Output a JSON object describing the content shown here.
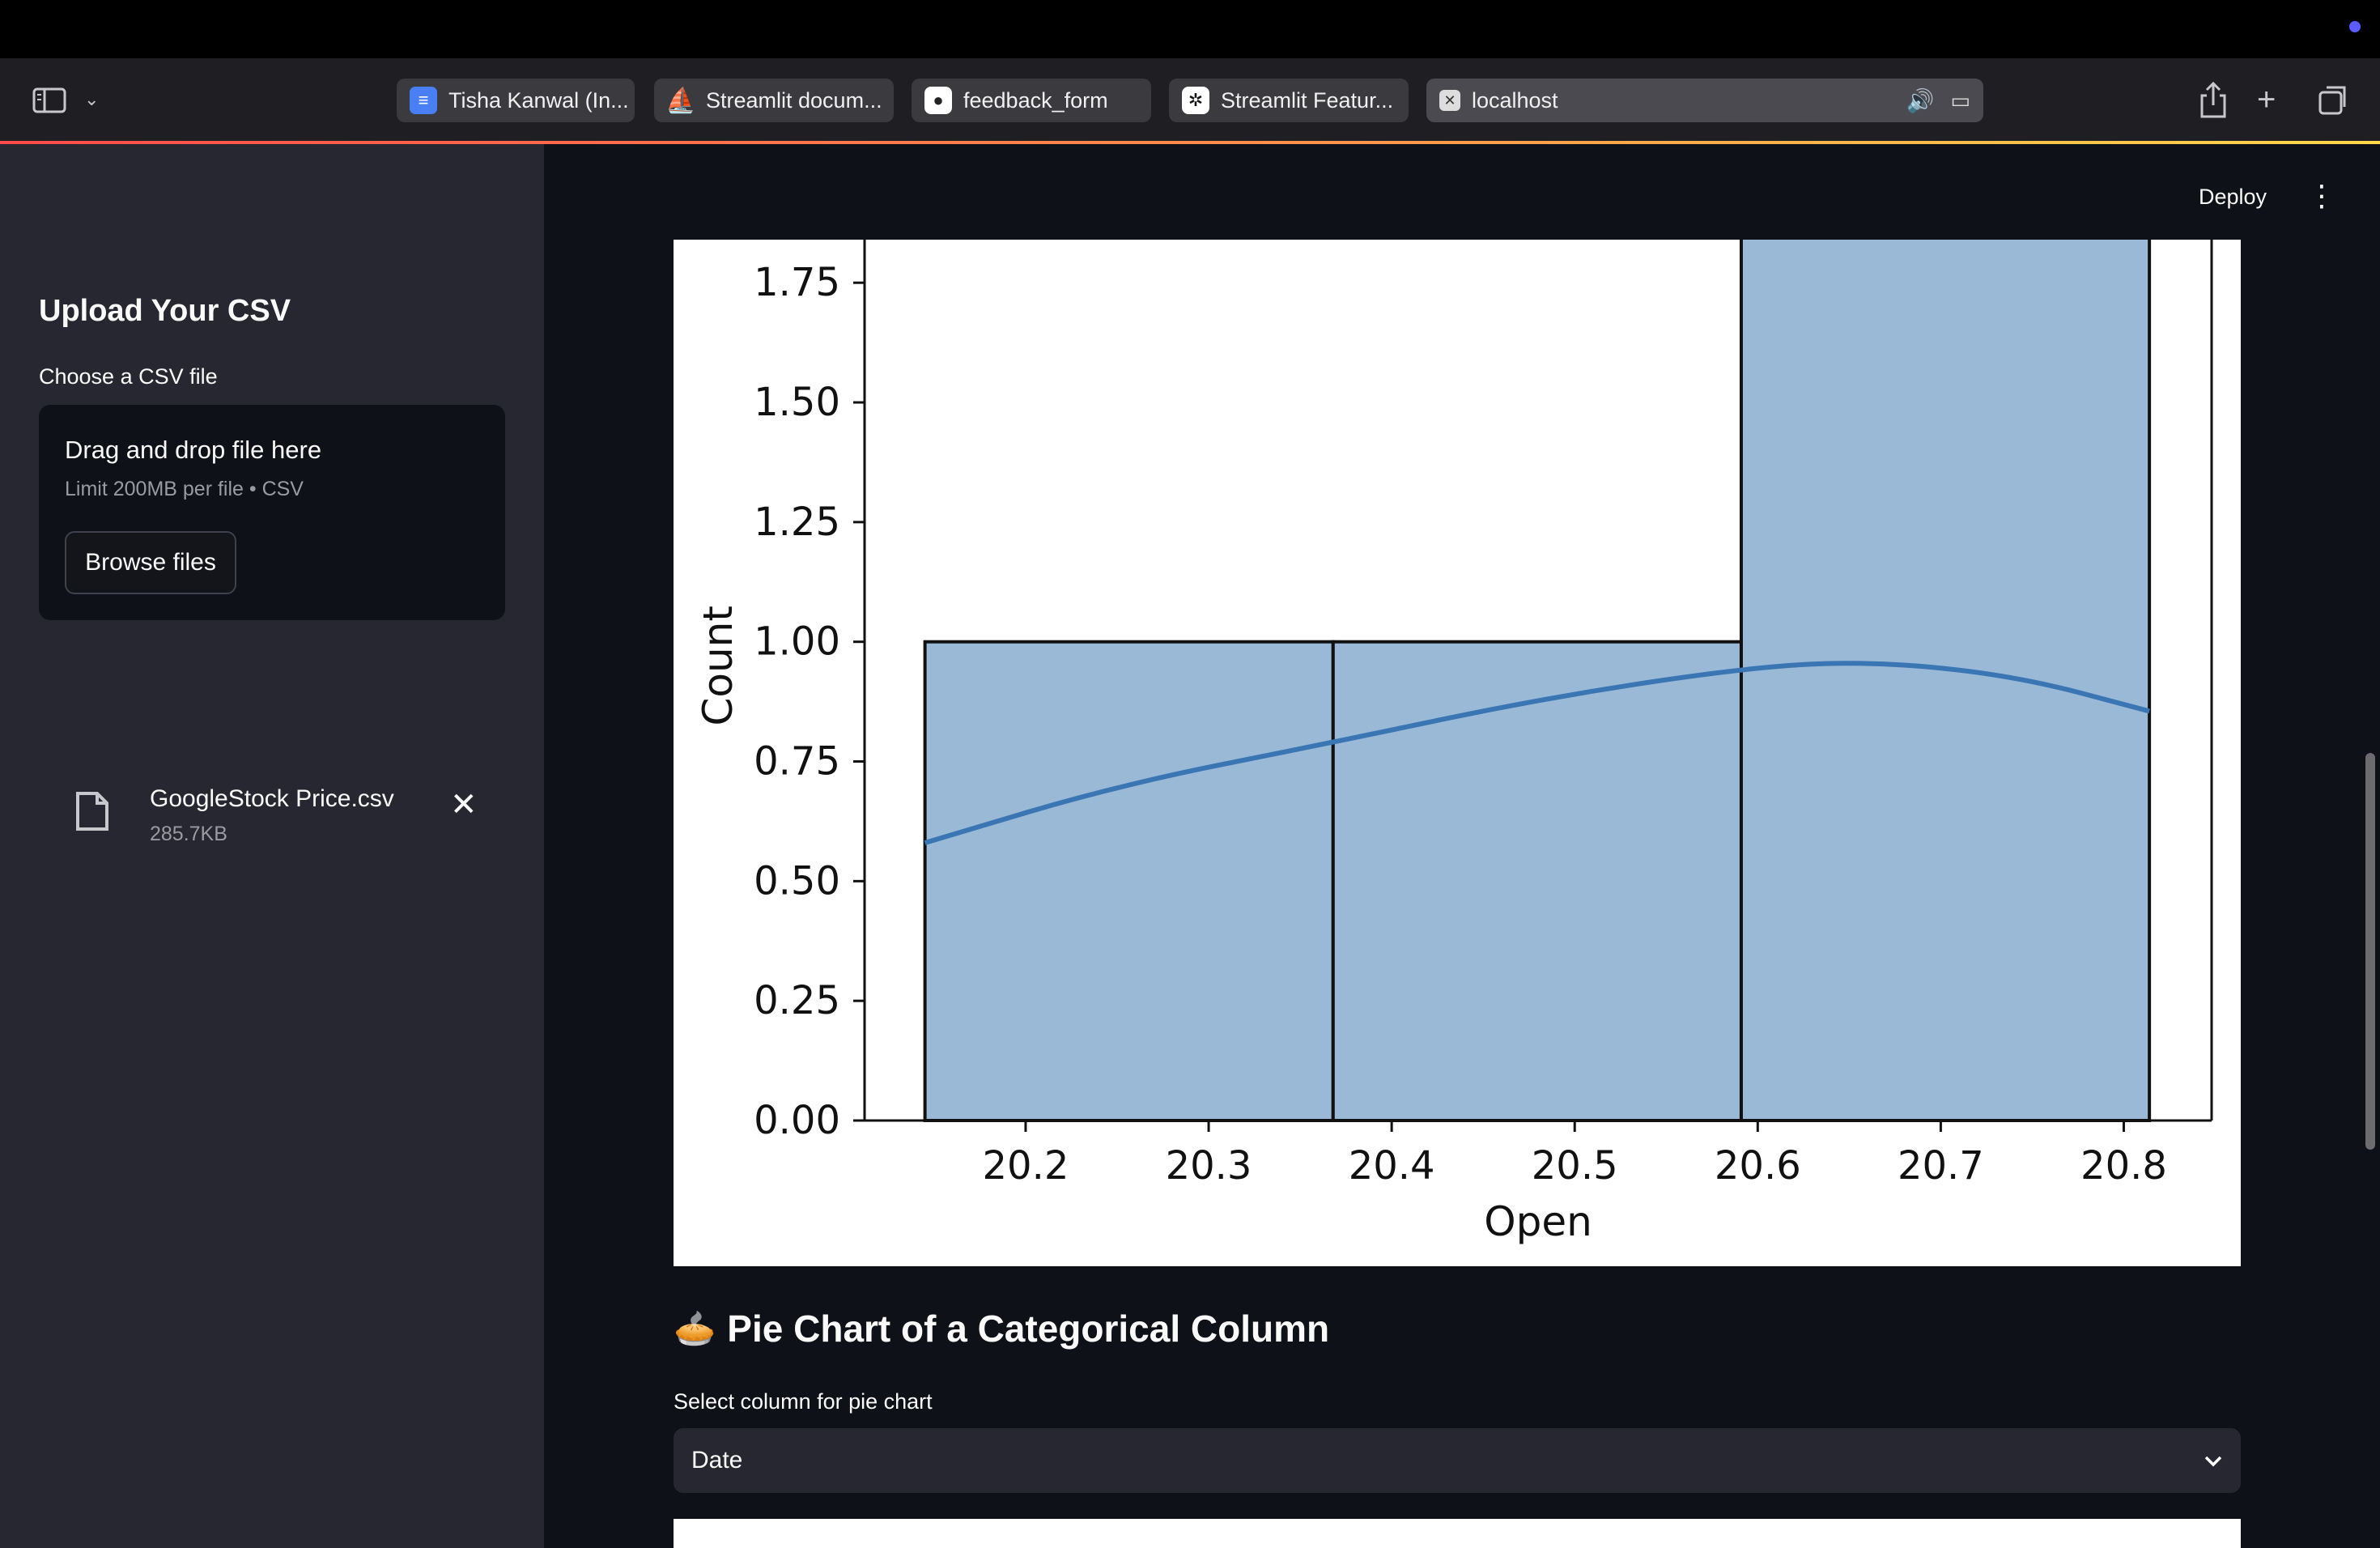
{
  "browser": {
    "tabs": [
      {
        "label": "Tisha Kanwal (In...",
        "icon": "google-docs-icon"
      },
      {
        "label": "Streamlit docum...",
        "icon": "streamlit-icon"
      },
      {
        "label": "feedback_form",
        "icon": "github-icon"
      },
      {
        "label": "Streamlit Featur...",
        "icon": "chatgpt-icon"
      },
      {
        "label": "localhost",
        "icon": "localhost-icon"
      }
    ],
    "accent": "#ff4b4b"
  },
  "sidebar": {
    "title": "Upload Your CSV",
    "uploader_label": "Choose a CSV file",
    "dropzone_title": "Drag and drop file here",
    "dropzone_sub": "Limit 200MB per file • CSV",
    "browse_label": "Browse files",
    "file": {
      "name": "GoogleStock Price.csv",
      "size": "285.7KB"
    }
  },
  "header": {
    "deploy_label": "Deploy"
  },
  "chart_data": {
    "type": "bar",
    "subtype": "histogram-with-kde",
    "xlabel": "Open",
    "ylabel": "Count",
    "bins": [
      {
        "x0": 20.145,
        "x1": 20.368,
        "count": 1
      },
      {
        "x0": 20.368,
        "x1": 20.591,
        "count": 1
      },
      {
        "x0": 20.591,
        "x1": 20.814,
        "count": 2
      }
    ],
    "kde": {
      "x": [
        20.145,
        20.25,
        20.368,
        20.48,
        20.591,
        20.66,
        20.74,
        20.814
      ],
      "y": [
        0.58,
        0.7,
        0.79,
        0.88,
        0.945,
        0.96,
        0.93,
        0.855
      ]
    },
    "xticks": [
      "20.2",
      "20.3",
      "20.4",
      "20.5",
      "20.6",
      "20.7",
      "20.8"
    ],
    "xtick_values": [
      20.2,
      20.3,
      20.4,
      20.5,
      20.6,
      20.7,
      20.8
    ],
    "yticks": [
      "0.00",
      "0.25",
      "0.50",
      "0.75",
      "1.00",
      "1.25",
      "1.50",
      "1.75"
    ],
    "ytick_values": [
      0,
      0.25,
      0.5,
      0.75,
      1.0,
      1.25,
      1.5,
      1.75
    ],
    "xlim": [
      20.112,
      20.848
    ],
    "ylim_visible": [
      0,
      1.84
    ],
    "bar_color": "#9ab9d6",
    "line_color": "#3a76b4"
  },
  "pie": {
    "heading": "Pie Chart of a Categorical Column",
    "heading_icon": "pie-icon",
    "select_label": "Select column for pie chart",
    "selected": "Date"
  }
}
